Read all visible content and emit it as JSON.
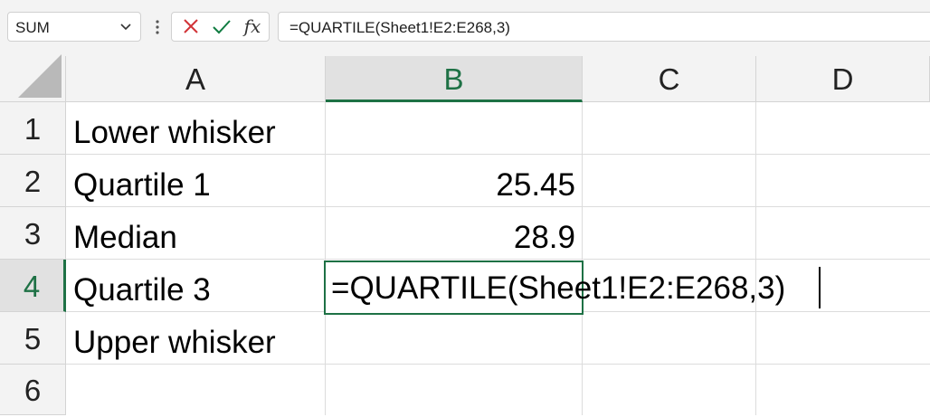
{
  "formula_bar": {
    "name_box": "SUM",
    "formula": "=QUARTILE(Sheet1!E2:E268,3)",
    "icons": [
      "chevron-down-icon",
      "more-options-icon",
      "cancel-icon",
      "enter-check-icon",
      "insert-function-icon"
    ],
    "fx_label": "fx"
  },
  "columns": [
    "A",
    "B",
    "C",
    "D"
  ],
  "rows": [
    "1",
    "2",
    "3",
    "4",
    "5",
    "6"
  ],
  "active": {
    "column": "B",
    "row": "4"
  },
  "cells": {
    "a1": "Lower whisker",
    "a2": "Quartile 1",
    "a3": "Median",
    "a4": "Quartile 3",
    "a5": "Upper whisker",
    "b2": "25.45",
    "b3": "28.9"
  },
  "edit_value": "=QUARTILE(Sheet1!E2:E268,3)",
  "colors": {
    "accent": "#1e7145",
    "cancel": "#d13438",
    "enter": "#107c41",
    "header_bg": "#f3f3f3",
    "gridline": "#dcdcdc"
  }
}
